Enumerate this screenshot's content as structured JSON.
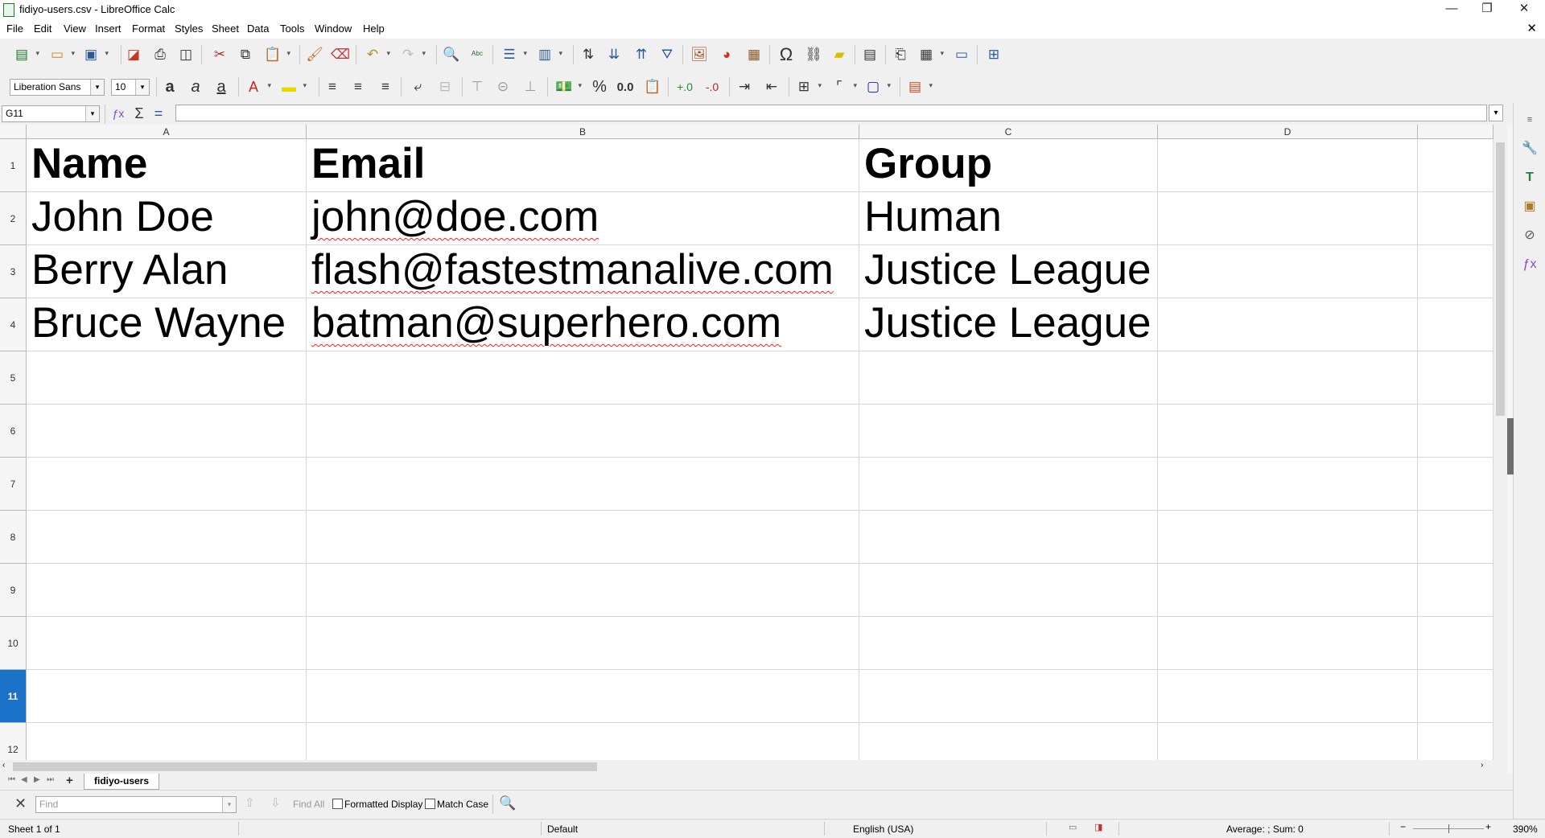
{
  "window": {
    "title": "fidiyo-users.csv - LibreOffice Calc",
    "controls": {
      "minimize": "—",
      "restore": "❐",
      "close": "✕"
    }
  },
  "menu": [
    "File",
    "Edit",
    "View",
    "Insert",
    "Format",
    "Styles",
    "Sheet",
    "Data",
    "Tools",
    "Window",
    "Help"
  ],
  "format_toolbar": {
    "font_name": "Liberation Sans",
    "font_size": "10",
    "percent": "%",
    "number": "0.0"
  },
  "formula_bar": {
    "name_box": "G11",
    "content": ""
  },
  "sheet": {
    "columns": [
      "A",
      "B",
      "C",
      "D"
    ],
    "rows": [
      "1",
      "2",
      "3",
      "4",
      "5",
      "6",
      "7",
      "8",
      "9",
      "10",
      "11",
      "12"
    ],
    "selected_row": "11",
    "cells": [
      [
        "Name",
        "Email",
        "Group"
      ],
      [
        "John Doe",
        "john@doe.com",
        "Human"
      ],
      [
        "Berry Alan",
        "flash@fastestmanalive.com",
        "Justice League"
      ],
      [
        "Bruce Wayne",
        "batman@superhero.com",
        "Justice League"
      ]
    ]
  },
  "tabs": {
    "add": "+",
    "active_sheet": "fidiyo-users"
  },
  "find_bar": {
    "placeholder": "Find",
    "find_all": "Find All",
    "formatted_display": "Formatted Display",
    "match_case": "Match Case"
  },
  "status": {
    "sheet": "Sheet 1 of 1",
    "page_style": "Default",
    "language": "English (USA)",
    "summary": "Average: ; Sum: 0",
    "zoom": "390%"
  }
}
